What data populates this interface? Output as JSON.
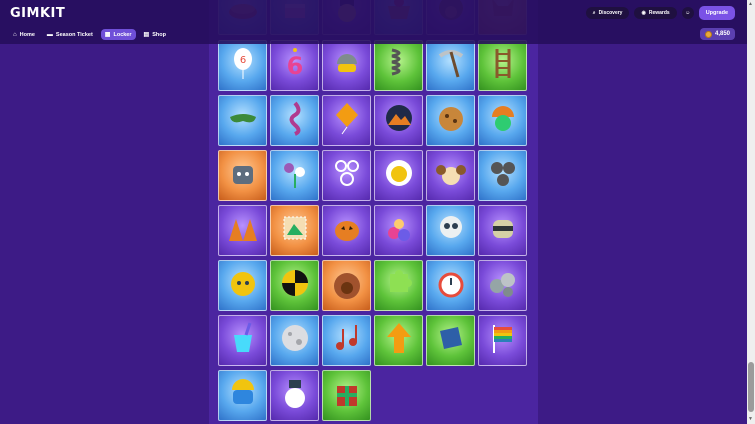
{
  "app": {
    "logo": "GIMKIT"
  },
  "nav": [
    {
      "label": "Home",
      "icon": "home-icon",
      "active": false
    },
    {
      "label": "Season Ticket",
      "icon": "ticket-icon",
      "active": false
    },
    {
      "label": "Locker",
      "icon": "locker-icon",
      "active": true
    },
    {
      "label": "Shop",
      "icon": "shop-icon",
      "active": false
    }
  ],
  "top_right": {
    "discovery_label": "Discovery",
    "rewards_label": "Rewards",
    "upgrade_label": "Upgrade",
    "currency_value": "4,850"
  },
  "colors": {
    "blue": "#58a8ee",
    "purple": "#7a4bd9",
    "green": "#5ec33a",
    "orange": "#f29144"
  },
  "locker": {
    "rows": [
      [
        {
          "icon": "pumpkin-pie-icon",
          "rarity": "blue"
        },
        {
          "icon": "cake-icon",
          "rarity": "blue"
        },
        {
          "icon": "gim-hat-icon",
          "rarity": "purple"
        },
        {
          "icon": "basket-icon",
          "rarity": "blue"
        },
        {
          "icon": "turkey-icon",
          "rarity": "purple"
        },
        {
          "icon": "fox-icon",
          "rarity": "orange"
        }
      ],
      [
        {
          "icon": "balloon-six-icon",
          "rarity": "blue"
        },
        {
          "icon": "candle-six-icon",
          "rarity": "purple"
        },
        {
          "icon": "gim-helmet-icon",
          "rarity": "purple"
        },
        {
          "icon": "spring-icon",
          "rarity": "green"
        },
        {
          "icon": "pickaxe-icon",
          "rarity": "blue"
        },
        {
          "icon": "ladder-icon",
          "rarity": "green"
        }
      ],
      [
        {
          "icon": "sleep-mask-icon",
          "rarity": "blue"
        },
        {
          "icon": "rope-icon",
          "rarity": "blue"
        },
        {
          "icon": "kite-icon",
          "rarity": "purple"
        },
        {
          "icon": "mountain-badge-icon",
          "rarity": "purple"
        },
        {
          "icon": "cookie-icon",
          "rarity": "blue"
        },
        {
          "icon": "helmet-gim-icon",
          "rarity": "blue"
        }
      ],
      [
        {
          "icon": "robot-gim-icon",
          "rarity": "orange"
        },
        {
          "icon": "flower-bouquet-icon",
          "rarity": "blue"
        },
        {
          "icon": "bubbles-icon",
          "rarity": "purple"
        },
        {
          "icon": "daisy-gim-icon",
          "rarity": "purple"
        },
        {
          "icon": "ram-gim-icon",
          "rarity": "purple"
        },
        {
          "icon": "smoke-puffs-icon",
          "rarity": "blue"
        }
      ],
      [
        {
          "icon": "tents-icon",
          "rarity": "purple"
        },
        {
          "icon": "map-stamp-icon",
          "rarity": "orange"
        },
        {
          "icon": "jack-o-lantern-icon",
          "rarity": "purple"
        },
        {
          "icon": "candy-pile-icon",
          "rarity": "purple"
        },
        {
          "icon": "skull-gim-icon",
          "rarity": "blue"
        },
        {
          "icon": "mummy-gim-icon",
          "rarity": "purple"
        }
      ],
      [
        {
          "icon": "yellow-gim-icon",
          "rarity": "blue"
        },
        {
          "icon": "crash-test-icon",
          "rarity": "green"
        },
        {
          "icon": "turkey-feathers-icon",
          "rarity": "orange"
        },
        {
          "icon": "puzzle-piece-icon",
          "rarity": "green"
        },
        {
          "icon": "alarm-clock-icon",
          "rarity": "blue"
        },
        {
          "icon": "rocks-icon",
          "rarity": "purple"
        }
      ],
      [
        {
          "icon": "paint-bucket-icon",
          "rarity": "purple"
        },
        {
          "icon": "moon-icon",
          "rarity": "blue"
        },
        {
          "icon": "music-notes-icon",
          "rarity": "blue"
        },
        {
          "icon": "up-arrow-icon",
          "rarity": "green"
        },
        {
          "icon": "book-icon",
          "rarity": "green"
        },
        {
          "icon": "rainbow-flag-icon",
          "rarity": "purple"
        }
      ],
      [
        {
          "icon": "construction-gim-icon",
          "rarity": "blue"
        },
        {
          "icon": "snowman-gim-icon",
          "rarity": "purple"
        },
        {
          "icon": "gift-box-icon",
          "rarity": "green"
        }
      ]
    ]
  }
}
